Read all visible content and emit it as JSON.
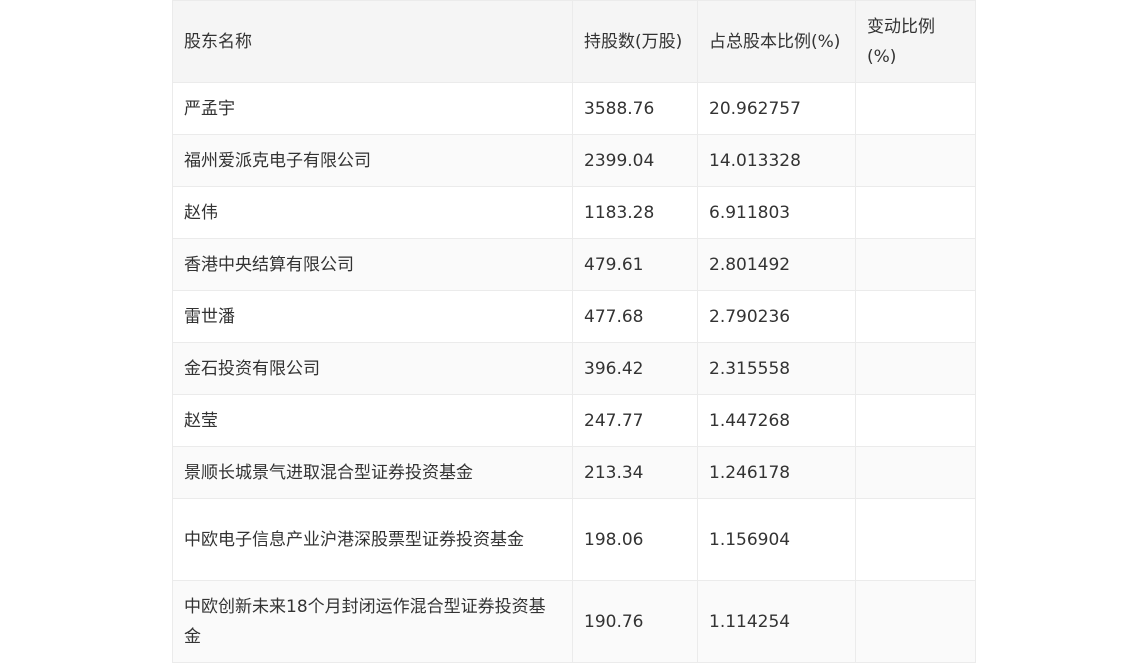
{
  "table": {
    "headers": [
      "股东名称",
      "持股数(万股)",
      "占总股本比例(%)",
      "变动比例(%)"
    ],
    "rows": [
      [
        "严孟宇",
        "3588.76",
        "20.962757",
        ""
      ],
      [
        "福州爱派克电子有限公司",
        "2399.04",
        "14.013328",
        ""
      ],
      [
        "赵伟",
        "1183.28",
        "6.911803",
        ""
      ],
      [
        "香港中央结算有限公司",
        "479.61",
        "2.801492",
        ""
      ],
      [
        "雷世潘",
        "477.68",
        "2.790236",
        ""
      ],
      [
        "金石投资有限公司",
        "396.42",
        "2.315558",
        ""
      ],
      [
        "赵莹",
        "247.77",
        "1.447268",
        ""
      ],
      [
        "景顺长城景气进取混合型证券投资基金",
        "213.34",
        "1.246178",
        ""
      ],
      [
        "中欧电子信息产业沪港深股票型证券投资基金",
        "198.06",
        "1.156904",
        ""
      ],
      [
        "中欧创新未来18个月封闭运作混合型证券投资基金",
        "190.76",
        "1.114254",
        ""
      ]
    ]
  }
}
